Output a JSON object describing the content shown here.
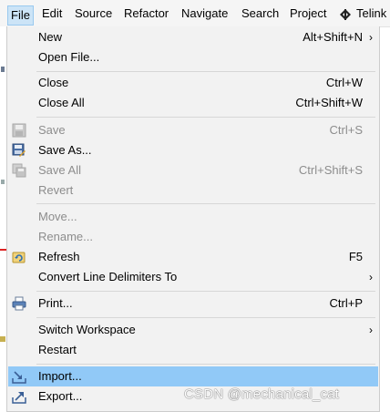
{
  "menubar": {
    "items": [
      "File",
      "Edit",
      "Source",
      "Refactor",
      "Navigate",
      "Search",
      "Project",
      "Telink"
    ]
  },
  "file_menu": {
    "new": {
      "label": "New",
      "shortcut": "Alt+Shift+N"
    },
    "open_file": {
      "label": "Open File..."
    },
    "close": {
      "label": "Close",
      "shortcut": "Ctrl+W"
    },
    "close_all": {
      "label": "Close All",
      "shortcut": "Ctrl+Shift+W"
    },
    "save": {
      "label": "Save",
      "shortcut": "Ctrl+S"
    },
    "save_as": {
      "label": "Save As..."
    },
    "save_all": {
      "label": "Save All",
      "shortcut": "Ctrl+Shift+S"
    },
    "revert": {
      "label": "Revert"
    },
    "move": {
      "label": "Move..."
    },
    "rename": {
      "label": "Rename..."
    },
    "refresh": {
      "label": "Refresh",
      "shortcut": "F5"
    },
    "convert": {
      "label": "Convert Line Delimiters To"
    },
    "print": {
      "label": "Print...",
      "shortcut": "Ctrl+P"
    },
    "switch_workspace": {
      "label": "Switch Workspace"
    },
    "restart": {
      "label": "Restart"
    },
    "import": {
      "label": "Import..."
    },
    "export": {
      "label": "Export..."
    }
  },
  "watermark": "CSDN @mechanical_cat",
  "colors": {
    "menu_bg": "#f2f2f2",
    "highlight": "#91c9f7",
    "active_menubar": "#cce4f7",
    "disabled_text": "#8d8d8d"
  },
  "icons": {
    "telink": "telink-logo-icon",
    "save": "floppy-disk-icon",
    "save_as": "floppy-disk-pencil-icon",
    "save_all": "floppy-disks-icon",
    "refresh": "refresh-icon",
    "print": "printer-icon",
    "import": "import-icon",
    "export": "export-icon"
  }
}
